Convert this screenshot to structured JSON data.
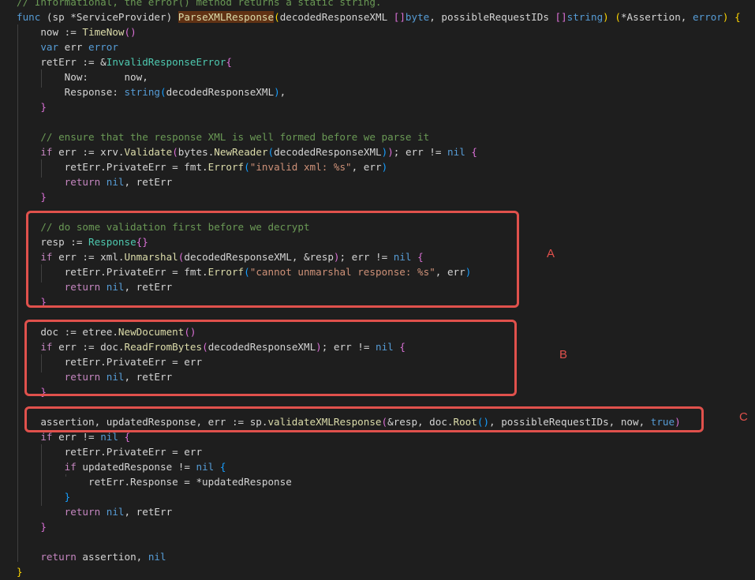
{
  "lines": [
    {
      "segs": [
        {
          "t": "// Informational, the error() method returns a static string.",
          "c": "cm"
        }
      ]
    },
    {
      "segs": [
        {
          "t": "func",
          "c": "kw"
        },
        {
          "t": " ("
        },
        {
          "t": "sp"
        },
        {
          "t": " *"
        },
        {
          "t": "ServiceProvider"
        },
        {
          "t": ") "
        },
        {
          "t": "ParseXMLResponse",
          "c": "fn hl"
        },
        {
          "t": "(",
          "c": "br"
        },
        {
          "t": "decodedResponseXML "
        },
        {
          "t": "[]",
          "c": "br2"
        },
        {
          "t": "byte",
          "c": "kw"
        },
        {
          "t": ", possibleRequestIDs "
        },
        {
          "t": "[]",
          "c": "br2"
        },
        {
          "t": "string",
          "c": "kw"
        },
        {
          "t": ")",
          "c": "br"
        },
        {
          "t": " "
        },
        {
          "t": "(",
          "c": "br"
        },
        {
          "t": "*Assertion, "
        },
        {
          "t": "error",
          "c": "kw"
        },
        {
          "t": ")",
          "c": "br"
        },
        {
          "t": " "
        },
        {
          "t": "{",
          "c": "br"
        }
      ]
    },
    {
      "segs": [
        {
          "t": "    now := "
        },
        {
          "t": "TimeNow",
          "c": "fn"
        },
        {
          "t": "()",
          "c": "br2"
        }
      ]
    },
    {
      "segs": [
        {
          "t": "    "
        },
        {
          "t": "var",
          "c": "kw"
        },
        {
          "t": " err "
        },
        {
          "t": "error",
          "c": "kw"
        }
      ]
    },
    {
      "segs": [
        {
          "t": "    retErr := &"
        },
        {
          "t": "InvalidResponseError",
          "c": "ty"
        },
        {
          "t": "{",
          "c": "br2"
        }
      ]
    },
    {
      "segs": [
        {
          "t": "        Now:      now,"
        }
      ]
    },
    {
      "segs": [
        {
          "t": "        Response: "
        },
        {
          "t": "string",
          "c": "kw"
        },
        {
          "t": "(",
          "c": "br3"
        },
        {
          "t": "decodedResponseXML"
        },
        {
          "t": ")",
          "c": "br3"
        },
        {
          "t": ","
        }
      ]
    },
    {
      "segs": [
        {
          "t": "    "
        },
        {
          "t": "}",
          "c": "br2"
        }
      ]
    },
    {
      "segs": [
        {
          "t": ""
        }
      ]
    },
    {
      "segs": [
        {
          "t": "    // ensure that the response XML is well formed before we parse it",
          "c": "cm"
        }
      ]
    },
    {
      "segs": [
        {
          "t": "    "
        },
        {
          "t": "if",
          "c": "ctl"
        },
        {
          "t": " err := xrv."
        },
        {
          "t": "Validate",
          "c": "fn"
        },
        {
          "t": "(",
          "c": "br2"
        },
        {
          "t": "bytes."
        },
        {
          "t": "NewReader",
          "c": "fn"
        },
        {
          "t": "(",
          "c": "br3"
        },
        {
          "t": "decodedResponseXML"
        },
        {
          "t": ")",
          "c": "br3"
        },
        {
          "t": ")",
          "c": "br2"
        },
        {
          "t": "; err != "
        },
        {
          "t": "nil",
          "c": "kw"
        },
        {
          "t": " "
        },
        {
          "t": "{",
          "c": "br2"
        }
      ]
    },
    {
      "segs": [
        {
          "t": "        retErr.PrivateErr = fmt."
        },
        {
          "t": "Errorf",
          "c": "fn"
        },
        {
          "t": "(",
          "c": "br3"
        },
        {
          "t": "\"invalid xml: %s\"",
          "c": "str"
        },
        {
          "t": ", err"
        },
        {
          "t": ")",
          "c": "br3"
        }
      ]
    },
    {
      "segs": [
        {
          "t": "        "
        },
        {
          "t": "return",
          "c": "ctl"
        },
        {
          "t": " "
        },
        {
          "t": "nil",
          "c": "kw"
        },
        {
          "t": ", retErr"
        }
      ]
    },
    {
      "segs": [
        {
          "t": "    "
        },
        {
          "t": "}",
          "c": "br2"
        }
      ]
    },
    {
      "segs": [
        {
          "t": ""
        }
      ]
    },
    {
      "segs": [
        {
          "t": "    // do some validation first before we decrypt",
          "c": "cm"
        }
      ]
    },
    {
      "segs": [
        {
          "t": "    resp := "
        },
        {
          "t": "Response",
          "c": "ty"
        },
        {
          "t": "{}",
          "c": "br2"
        }
      ]
    },
    {
      "segs": [
        {
          "t": "    "
        },
        {
          "t": "if",
          "c": "ctl"
        },
        {
          "t": " err := xml."
        },
        {
          "t": "Unmarshal",
          "c": "fn"
        },
        {
          "t": "(",
          "c": "br2"
        },
        {
          "t": "decodedResponseXML, &resp"
        },
        {
          "t": ")",
          "c": "br2"
        },
        {
          "t": "; err != "
        },
        {
          "t": "nil",
          "c": "kw"
        },
        {
          "t": " "
        },
        {
          "t": "{",
          "c": "br2"
        }
      ]
    },
    {
      "segs": [
        {
          "t": "        retErr.PrivateErr = fmt."
        },
        {
          "t": "Errorf",
          "c": "fn"
        },
        {
          "t": "(",
          "c": "br3"
        },
        {
          "t": "\"cannot unmarshal response: %s\"",
          "c": "str"
        },
        {
          "t": ", err"
        },
        {
          "t": ")",
          "c": "br3"
        }
      ]
    },
    {
      "segs": [
        {
          "t": "        "
        },
        {
          "t": "return",
          "c": "ctl"
        },
        {
          "t": " "
        },
        {
          "t": "nil",
          "c": "kw"
        },
        {
          "t": ", retErr"
        }
      ]
    },
    {
      "segs": [
        {
          "t": "    "
        },
        {
          "t": "}",
          "c": "br2"
        }
      ]
    },
    {
      "segs": [
        {
          "t": ""
        }
      ]
    },
    {
      "segs": [
        {
          "t": "    doc := etree."
        },
        {
          "t": "NewDocument",
          "c": "fn"
        },
        {
          "t": "()",
          "c": "br2"
        }
      ]
    },
    {
      "segs": [
        {
          "t": "    "
        },
        {
          "t": "if",
          "c": "ctl"
        },
        {
          "t": " err := doc."
        },
        {
          "t": "ReadFromBytes",
          "c": "fn"
        },
        {
          "t": "(",
          "c": "br2"
        },
        {
          "t": "decodedResponseXML"
        },
        {
          "t": ")",
          "c": "br2"
        },
        {
          "t": "; err != "
        },
        {
          "t": "nil",
          "c": "kw"
        },
        {
          "t": " "
        },
        {
          "t": "{",
          "c": "br2"
        }
      ]
    },
    {
      "segs": [
        {
          "t": "        retErr.PrivateErr = err"
        }
      ]
    },
    {
      "segs": [
        {
          "t": "        "
        },
        {
          "t": "return",
          "c": "ctl"
        },
        {
          "t": " "
        },
        {
          "t": "nil",
          "c": "kw"
        },
        {
          "t": ", retErr"
        }
      ]
    },
    {
      "segs": [
        {
          "t": "    "
        },
        {
          "t": "}",
          "c": "br2"
        }
      ]
    },
    {
      "segs": [
        {
          "t": ""
        }
      ]
    },
    {
      "segs": [
        {
          "t": "    assertion, updatedResponse, err := sp."
        },
        {
          "t": "validateXMLResponse",
          "c": "fn"
        },
        {
          "t": "(",
          "c": "br2"
        },
        {
          "t": "&resp, doc."
        },
        {
          "t": "Root",
          "c": "fn"
        },
        {
          "t": "()",
          "c": "br3"
        },
        {
          "t": ", possibleRequestIDs, now, "
        },
        {
          "t": "true",
          "c": "kw"
        },
        {
          "t": ")",
          "c": "br2"
        }
      ]
    },
    {
      "segs": [
        {
          "t": "    "
        },
        {
          "t": "if",
          "c": "ctl"
        },
        {
          "t": " err != "
        },
        {
          "t": "nil",
          "c": "kw"
        },
        {
          "t": " "
        },
        {
          "t": "{",
          "c": "br2"
        }
      ]
    },
    {
      "segs": [
        {
          "t": "        retErr.PrivateErr = err"
        }
      ]
    },
    {
      "segs": [
        {
          "t": "        "
        },
        {
          "t": "if",
          "c": "ctl"
        },
        {
          "t": " updatedResponse != "
        },
        {
          "t": "nil",
          "c": "kw"
        },
        {
          "t": " "
        },
        {
          "t": "{",
          "c": "br3"
        }
      ]
    },
    {
      "segs": [
        {
          "t": "            retErr.Response = *updatedResponse"
        }
      ]
    },
    {
      "segs": [
        {
          "t": "        "
        },
        {
          "t": "}",
          "c": "br3"
        }
      ]
    },
    {
      "segs": [
        {
          "t": "        "
        },
        {
          "t": "return",
          "c": "ctl"
        },
        {
          "t": " "
        },
        {
          "t": "nil",
          "c": "kw"
        },
        {
          "t": ", retErr"
        }
      ]
    },
    {
      "segs": [
        {
          "t": "    "
        },
        {
          "t": "}",
          "c": "br2"
        }
      ]
    },
    {
      "segs": [
        {
          "t": ""
        }
      ]
    },
    {
      "segs": [
        {
          "t": "    "
        },
        {
          "t": "return",
          "c": "ctl"
        },
        {
          "t": " assertion, "
        },
        {
          "t": "nil",
          "c": "kw"
        }
      ]
    },
    {
      "segs": [
        {
          "t": "}",
          "c": "br"
        }
      ]
    }
  ],
  "annotations": [
    {
      "id": "A",
      "label": "A"
    },
    {
      "id": "B",
      "label": "B"
    },
    {
      "id": "C",
      "label": "C"
    }
  ]
}
